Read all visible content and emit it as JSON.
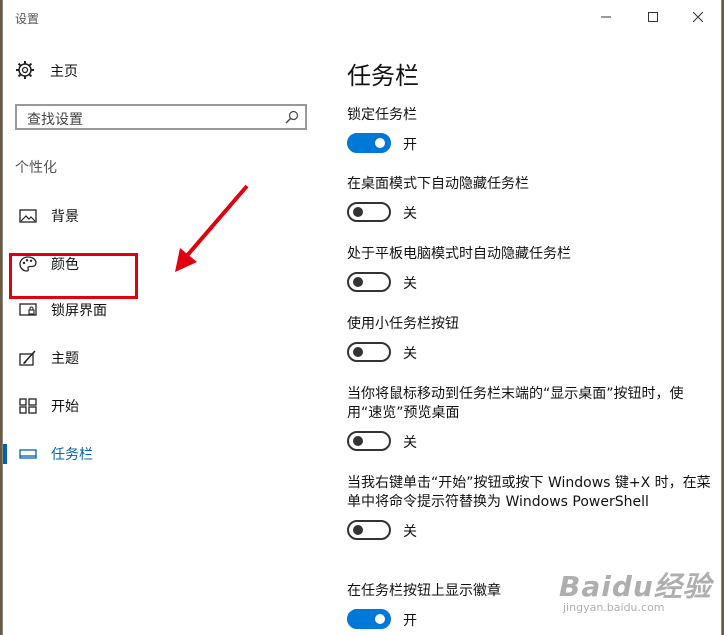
{
  "window": {
    "title": "设置"
  },
  "sidebar": {
    "home_label": "主页",
    "search_placeholder": "查找设置",
    "section_label": "个性化",
    "items": [
      {
        "label": "背景",
        "icon": "picture-icon"
      },
      {
        "label": "颜色",
        "icon": "palette-icon"
      },
      {
        "label": "锁屏界面",
        "icon": "lock-screen-icon"
      },
      {
        "label": "主题",
        "icon": "theme-icon"
      },
      {
        "label": "开始",
        "icon": "start-icon"
      },
      {
        "label": "任务栏",
        "icon": "taskbar-icon",
        "active": true
      }
    ]
  },
  "main": {
    "heading": "任务栏",
    "settings": [
      {
        "label": "锁定任务栏",
        "on": true,
        "state": "开"
      },
      {
        "label": "在桌面模式下自动隐藏任务栏",
        "on": false,
        "state": "关"
      },
      {
        "label": "处于平板电脑模式时自动隐藏任务栏",
        "on": false,
        "state": "关"
      },
      {
        "label": "使用小任务栏按钮",
        "on": false,
        "state": "关"
      },
      {
        "label": "当你将鼠标移动到任务栏末端的“显示桌面”按钮时，使用“速览”预览桌面",
        "on": false,
        "state": "关"
      },
      {
        "label": "当我右键单击“开始”按钮或按下 Windows 键+X 时，在菜单中将命令提示符替换为 Windows PowerShell",
        "on": false,
        "state": "关"
      },
      {
        "label": "在任务栏按钮上显示徽章",
        "on": true,
        "state": "开"
      }
    ]
  },
  "watermark": {
    "text": "Baidu经验",
    "url": "jingyan.baidu.com"
  },
  "colors": {
    "accent": "#0078d7",
    "active_text": "#0063b1",
    "annotation_red": "#e0000f"
  }
}
